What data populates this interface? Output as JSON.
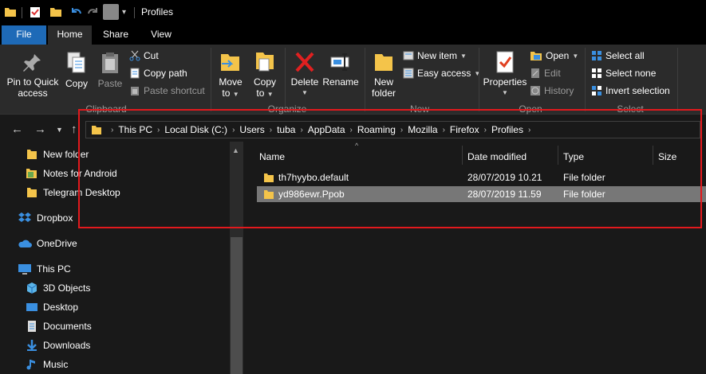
{
  "window": {
    "title": "Profiles"
  },
  "tabs": [
    {
      "label": "File"
    },
    {
      "label": "Home"
    },
    {
      "label": "Share"
    },
    {
      "label": "View"
    }
  ],
  "ribbon": {
    "clipboard": {
      "pin_label_1": "Pin to Quick",
      "pin_label_2": "access",
      "copy": "Copy",
      "paste": "Paste",
      "cut": "Cut",
      "copy_path": "Copy path",
      "paste_shortcut": "Paste shortcut",
      "group": "Clipboard"
    },
    "organize": {
      "move_to_1": "Move",
      "move_to_2": "to",
      "copy_to_1": "Copy",
      "copy_to_2": "to",
      "delete": "Delete",
      "rename": "Rename",
      "group": "Organize"
    },
    "new": {
      "new_folder_1": "New",
      "new_folder_2": "folder",
      "new_item": "New item",
      "easy_access": "Easy access",
      "group": "New"
    },
    "open": {
      "properties": "Properties",
      "open": "Open",
      "edit": "Edit",
      "history": "History",
      "group": "Open"
    },
    "select": {
      "select_all": "Select all",
      "select_none": "Select none",
      "invert": "Invert selection",
      "group": "Select"
    }
  },
  "breadcrumb": [
    "This PC",
    "Local Disk (C:)",
    "Users",
    "tuba",
    "AppData",
    "Roaming",
    "Mozilla",
    "Firefox",
    "Profiles"
  ],
  "nav": {
    "items": [
      {
        "label": "New folder"
      },
      {
        "label": "Notes for Android"
      },
      {
        "label": "Telegram Desktop"
      },
      {
        "label": "Dropbox"
      },
      {
        "label": "OneDrive"
      },
      {
        "label": "This PC"
      },
      {
        "label": "3D Objects"
      },
      {
        "label": "Desktop"
      },
      {
        "label": "Documents"
      },
      {
        "label": "Downloads"
      },
      {
        "label": "Music"
      }
    ]
  },
  "columns": {
    "name": "Name",
    "date": "Date modified",
    "type": "Type",
    "size": "Size"
  },
  "files": [
    {
      "name": "th7hyybo.default",
      "date": "28/07/2019 10.21",
      "type": "File folder",
      "selected": false
    },
    {
      "name": "yd986ewr.Ppob",
      "date": "28/07/2019 11.59",
      "type": "File folder",
      "selected": true
    }
  ],
  "colors": {
    "accent": "#1e6ab7",
    "highlight": "#e2191d",
    "folder": "#f4c44a",
    "selected_row": "#777777"
  }
}
